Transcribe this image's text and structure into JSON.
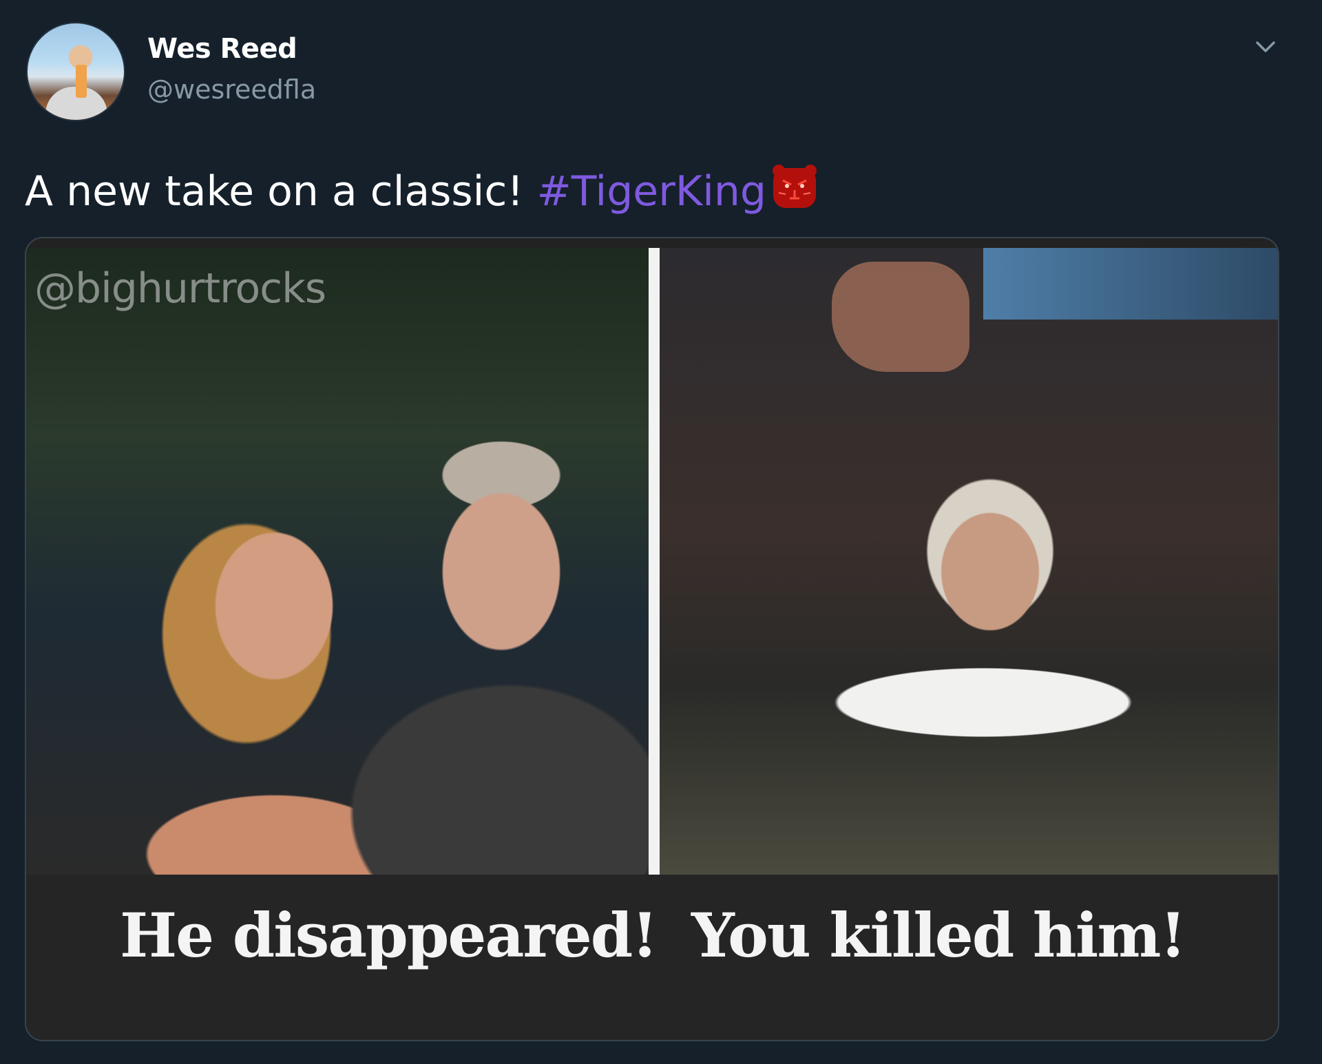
{
  "user": {
    "display_name": "Wes Reed",
    "handle": "@wesreedfla"
  },
  "tweet": {
    "text": "A new take on a classic! ",
    "hashtag": "#TigerKing",
    "emoji": "tiger-face-icon"
  },
  "media": {
    "watermark": "@bighurtrocks",
    "caption_left": "He disappeared!",
    "caption_right": "You killed him!"
  },
  "colors": {
    "background": "#15202b",
    "hashtag": "#7f5ae0",
    "handle": "#8899a6"
  }
}
